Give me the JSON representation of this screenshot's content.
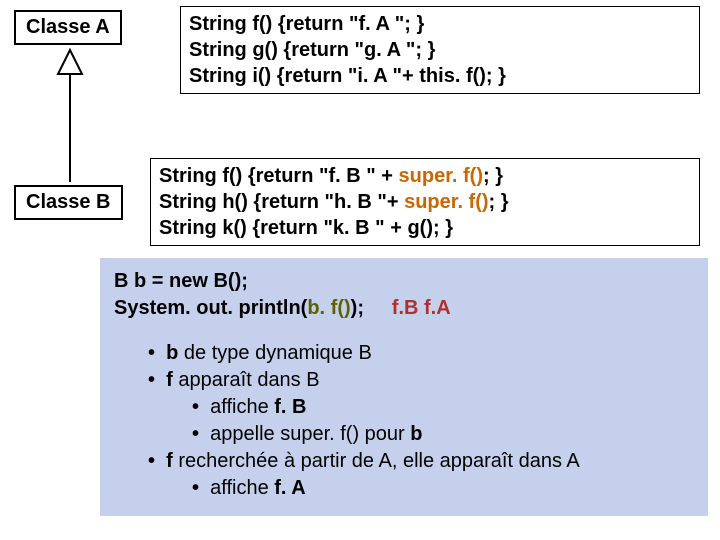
{
  "classA": {
    "label": "Classe A",
    "methods": {
      "f": "String f() {return \"f. A \"; }",
      "g": "String g() {return \"g. A \"; }",
      "i": "String i() {return \"i. A \"+ this. f(); }"
    }
  },
  "classB": {
    "label": "Classe B",
    "methods": {
      "f_pre": "String f() {return \"f. B \" + ",
      "f_super": "super. f()",
      "f_post": "; }",
      "h_pre": "String h() {return \"h. B \"+ ",
      "h_super": "super. f()",
      "h_post": "; }",
      "k": "String k() {return \"k. B \" + g(); }"
    }
  },
  "exec": {
    "line1": "B b = new B();",
    "line2_pre": "System. out. println(",
    "line2_arg": "b. f()",
    "line2_post": ");",
    "output": "f.B f.A"
  },
  "notes": {
    "n1_pre": "b",
    "n1_rest": " de type dynamique B",
    "n2_pre": "f",
    "n2_rest": " apparaît dans B",
    "n2a_pre": "affiche ",
    "n2a_bold": "f. B",
    "n2b_pre": "appelle super. f() pour ",
    "n2b_bold": "b",
    "n3_pre": "f",
    "n3_rest": " recherchée à partir de A, elle apparaît dans A",
    "n3a_pre": "affiche ",
    "n3a_bold": "f. A"
  },
  "bullet": "•"
}
